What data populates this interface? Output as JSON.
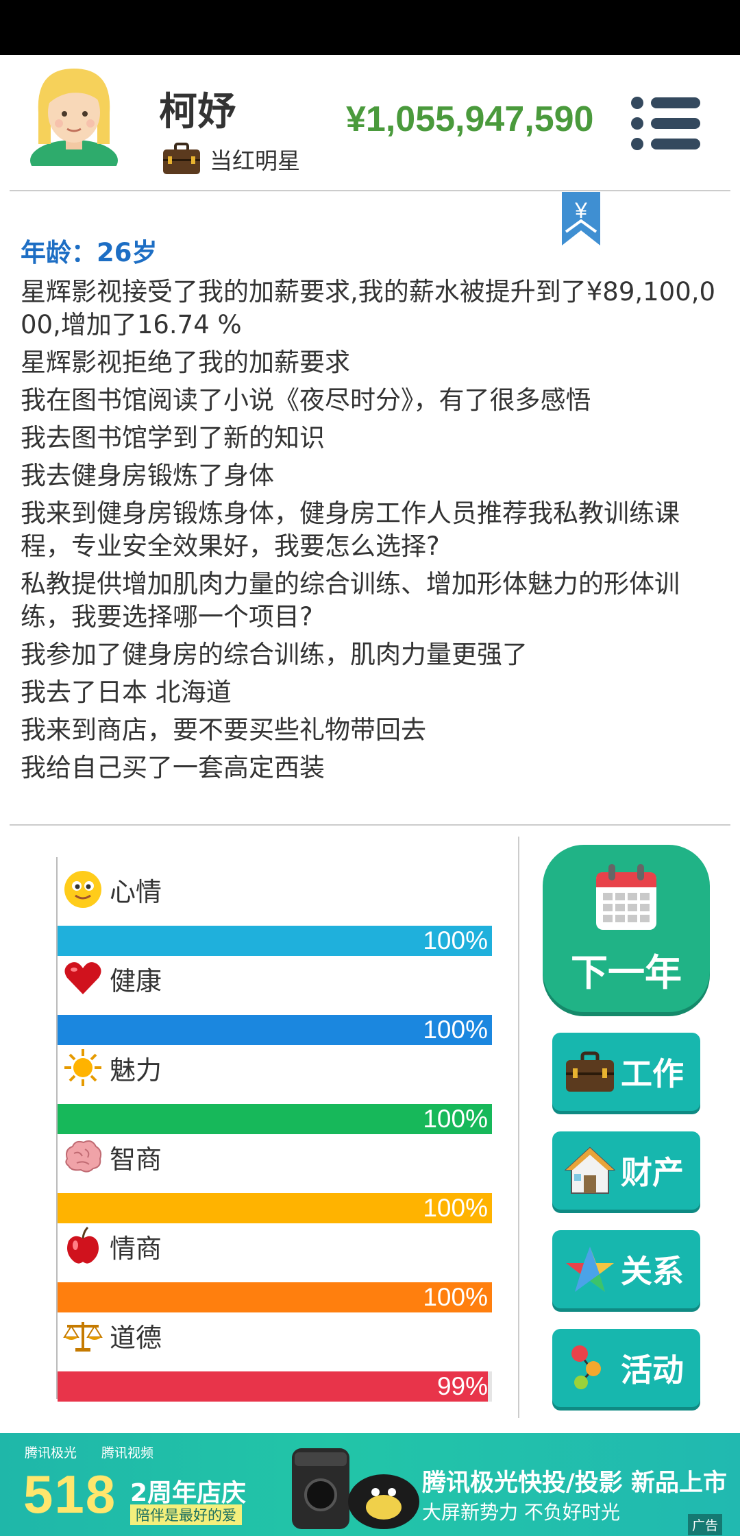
{
  "header": {
    "name": "柯妤",
    "job": "当红明星",
    "money": "¥1,055,947,590"
  },
  "log": {
    "age": "年龄：26岁",
    "entries": [
      "星辉影视接受了我的加薪要求,我的薪水被提升到了¥89,100,000,增加了16.74 %",
      "星辉影视拒绝了我的加薪要求",
      "我在图书馆阅读了小说《夜尽时分》，有了很多感悟",
      "我去图书馆学到了新的知识",
      "我去健身房锻炼了身体",
      "我来到健身房锻炼身体，健身房工作人员推荐我私教训练课程，专业安全效果好，我要怎么选择?",
      "私教提供增加肌肉力量的综合训练、增加形体魅力的形体训练，我要选择哪一个项目?",
      "我参加了健身房的综合训练，肌肉力量更强了",
      "我去了日本 北海道",
      "我来到商店，要不要买些礼物带回去",
      "我给自己买了一套高定西装"
    ]
  },
  "stats": [
    {
      "label": "心情",
      "value": 100,
      "pct": "100%",
      "color": "#1fb0dc",
      "icon": "smiley-icon"
    },
    {
      "label": "健康",
      "value": 100,
      "pct": "100%",
      "color": "#1b87df",
      "icon": "heart-icon"
    },
    {
      "label": "魅力",
      "value": 100,
      "pct": "100%",
      "color": "#17b85a",
      "icon": "sun-icon"
    },
    {
      "label": "智商",
      "value": 100,
      "pct": "100%",
      "color": "#ffb300",
      "icon": "brain-icon"
    },
    {
      "label": "情商",
      "value": 100,
      "pct": "100%",
      "color": "#ff7f0e",
      "icon": "apple-icon"
    },
    {
      "label": "道德",
      "value": 99,
      "pct": "99%",
      "color": "#e8344a",
      "icon": "scales-icon"
    }
  ],
  "buttons": {
    "next_year": "下一年",
    "work": "工作",
    "property": "财产",
    "relation": "关系",
    "activity": "活动"
  },
  "ad": {
    "brand1": "腾讯极光",
    "brand2": "腾讯视频",
    "number": "518",
    "anniversary": "2周年店庆",
    "anniversary_sub": "陪伴是最好的爱",
    "headline": "腾讯极光快投/投影 新品上市",
    "subline": "大屏新势力  不负好时光",
    "tag": "广告"
  }
}
